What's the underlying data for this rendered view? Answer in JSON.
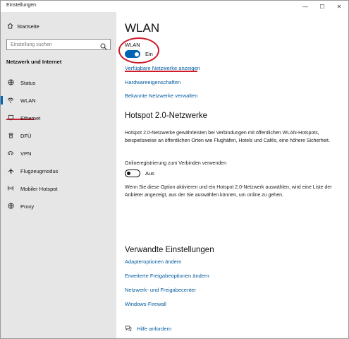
{
  "window": {
    "title": "Einstellungen",
    "minimize_glyph": "—",
    "maximize_glyph": "☐",
    "close_glyph": "✕"
  },
  "sidebar": {
    "home_label": "Startseite",
    "search_placeholder": "Einstellung suchen",
    "section_title": "Netzwerk und Internet",
    "items": [
      {
        "label": "Status",
        "icon": "globe-status-icon",
        "active": false
      },
      {
        "label": "WLAN",
        "icon": "wifi-icon",
        "active": true
      },
      {
        "label": "Ethernet",
        "icon": "ethernet-icon",
        "active": false
      },
      {
        "label": "DFÜ",
        "icon": "dialup-icon",
        "active": false
      },
      {
        "label": "VPN",
        "icon": "vpn-icon",
        "active": false
      },
      {
        "label": "Flugzeugmodus",
        "icon": "airplane-icon",
        "active": false
      },
      {
        "label": "Mobiler Hotspot",
        "icon": "hotspot-icon",
        "active": false
      },
      {
        "label": "Proxy",
        "icon": "proxy-globe-icon",
        "active": false
      }
    ]
  },
  "main": {
    "page_title": "WLAN",
    "wlan_toggle": {
      "label": "WLAN",
      "state": "Ein",
      "on": true
    },
    "links": {
      "available_networks": "Verfügbare Netzwerke anzeigen",
      "hardware_properties": "Hardwareeigenschaften",
      "known_networks": "Bekannte Netzwerke verwalten"
    },
    "hotspot": {
      "heading": "Hotspot 2.0-Netzwerke",
      "description": "Hotspot 2.0-Netzwerke gewährleisten bei Verbindungen mit öffentlichen WLAN-Hotspots, beispielsweise an öffentlichen Orten wie Flughäfen, Hotels und Cafés, eine höhere Sicherheit.",
      "online_reg_label": "Onlineregistrierung zum Verbinden verwenden",
      "toggle_state": "Aus",
      "toggle_on": false,
      "info": "Wenn Sie diese Option aktivieren und ein Hotspot 2.0-Netzwerk auswählen, wird eine Liste der Anbieter angezeigt, aus der Sie auswählen können, um online zu gehen."
    },
    "related": {
      "heading": "Verwandte Einstellungen",
      "links": [
        "Adapteroptionen ändern",
        "Erweiterte Freigabeoptionen ändern",
        "Netzwerk- und Freigabecenter",
        "Windows-Firewall"
      ]
    },
    "help": {
      "label": "Hilfe anfordern",
      "icon": "help-chat-icon"
    },
    "annotation_color": "#d01b2a",
    "accent_color": "#0063b1",
    "link_color": "#005a9e"
  }
}
